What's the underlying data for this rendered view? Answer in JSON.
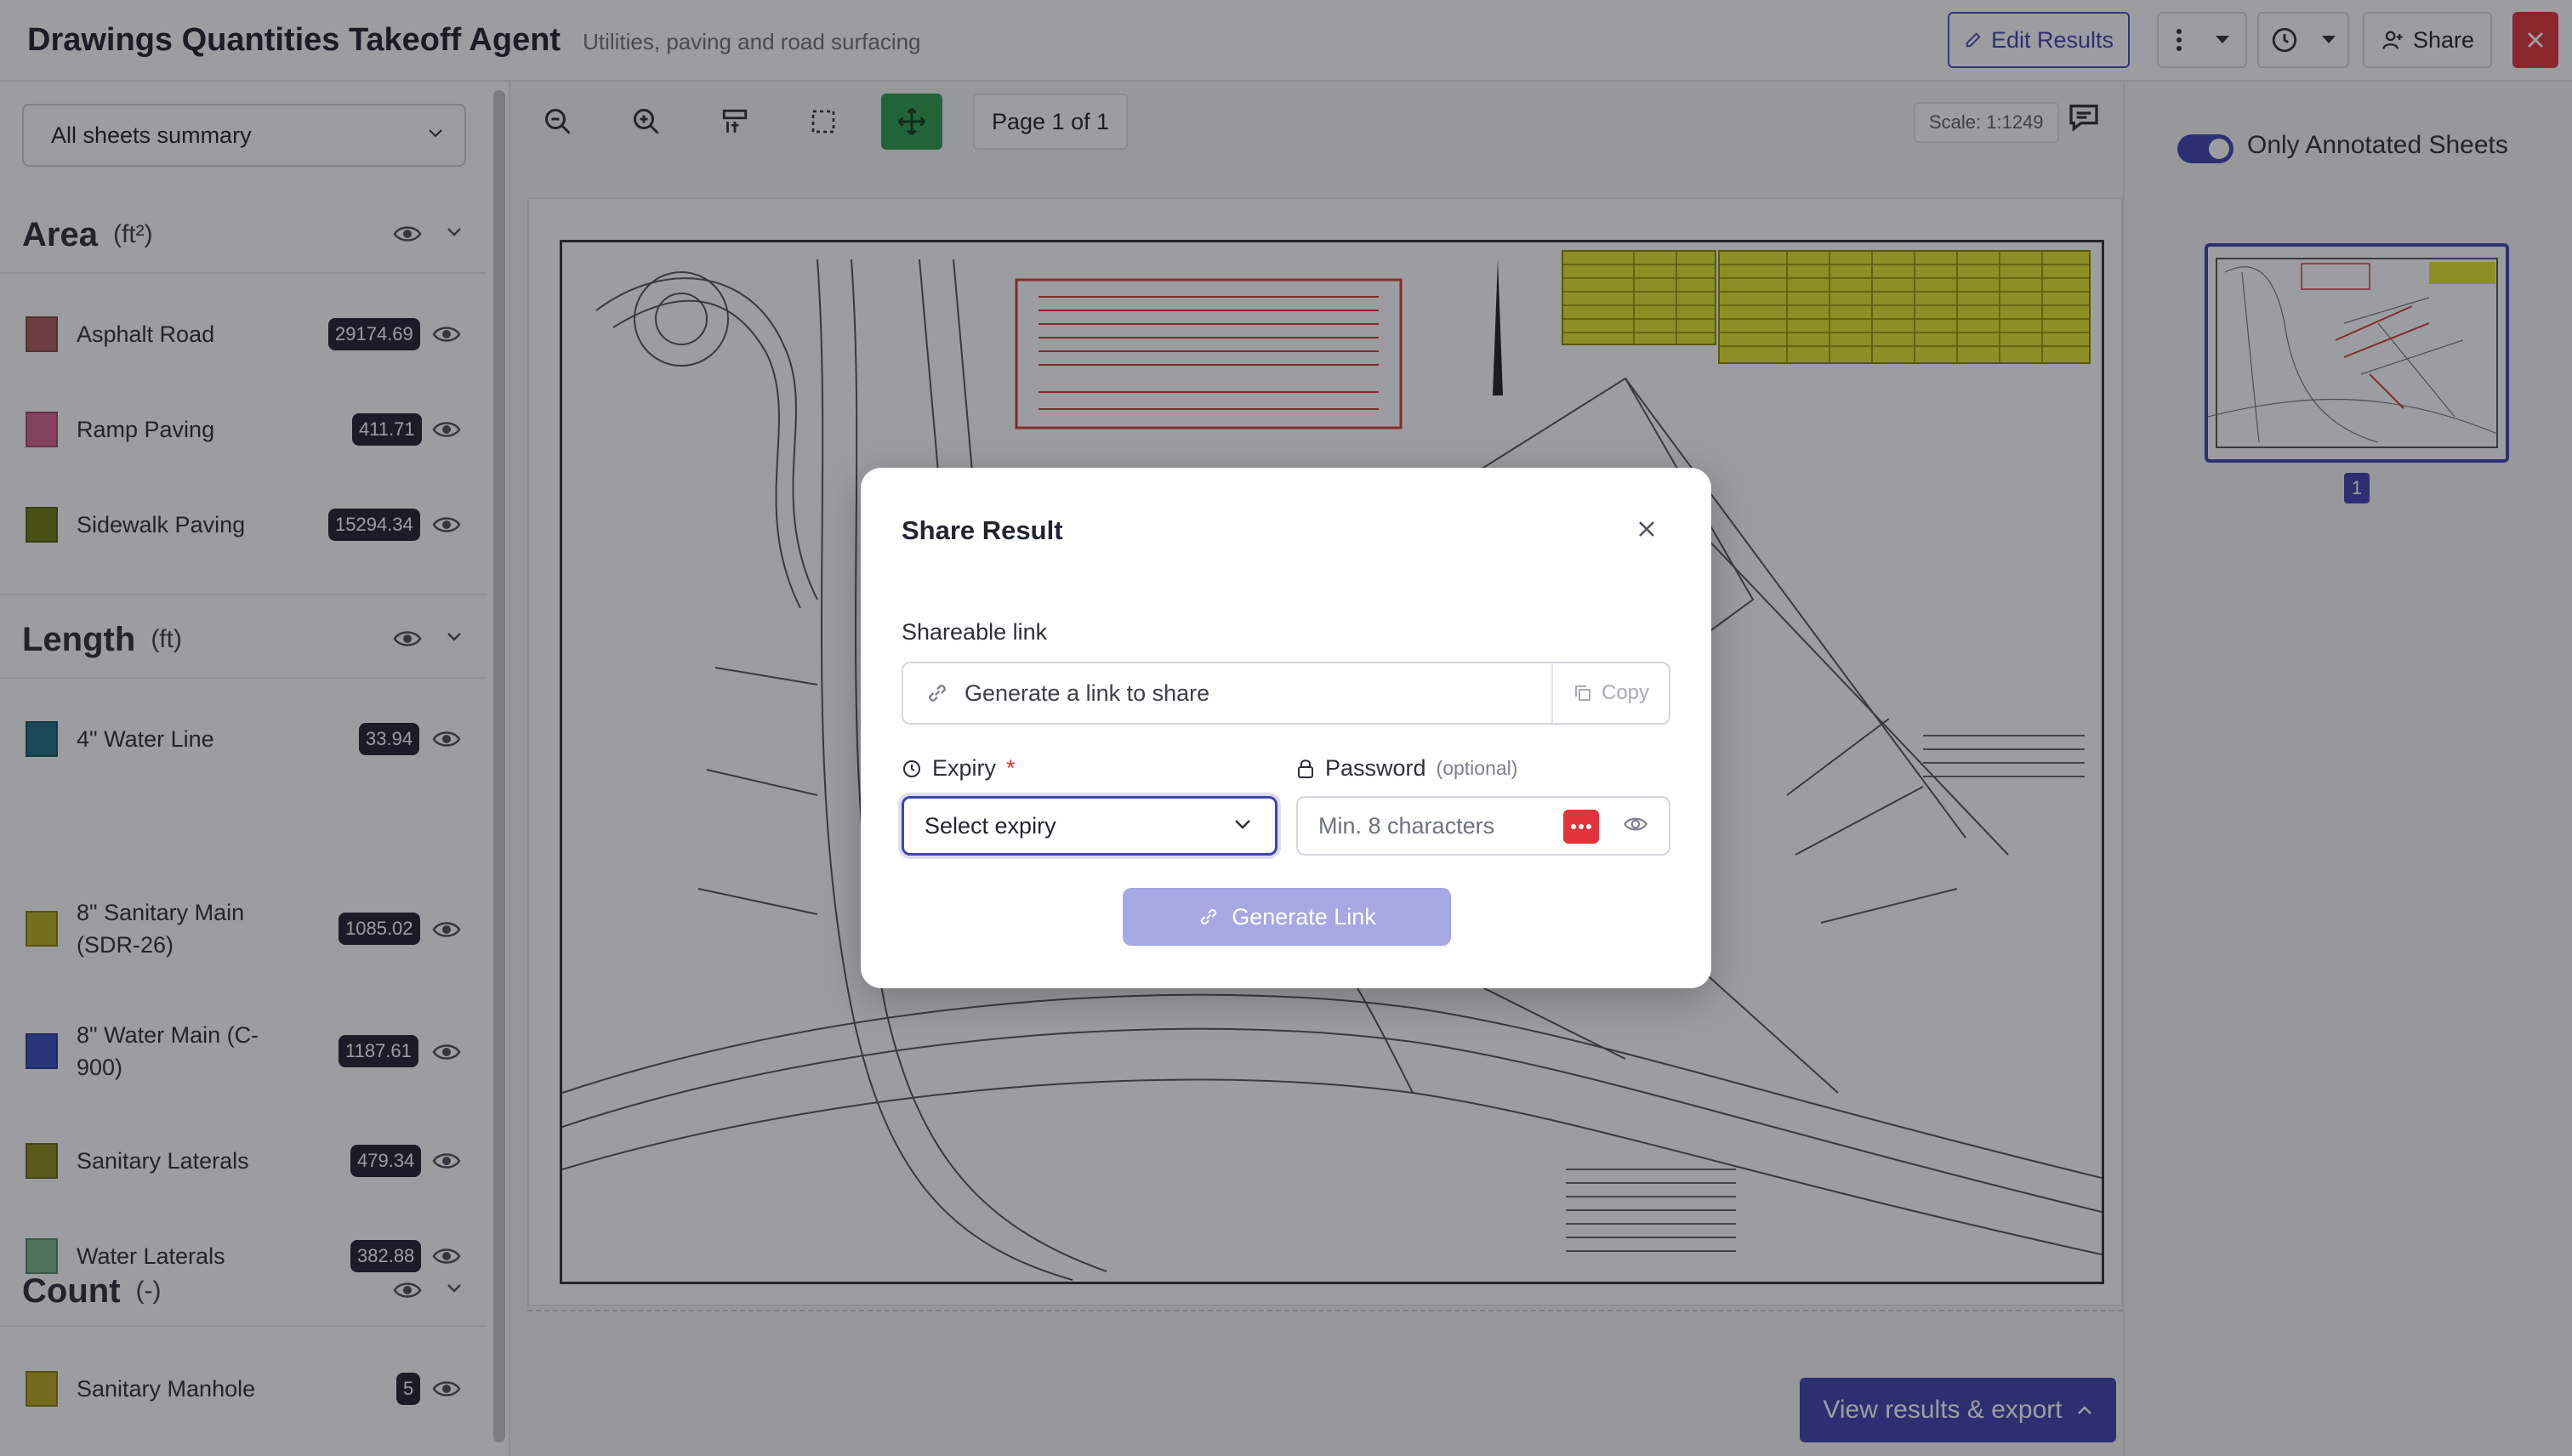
{
  "header": {
    "title": "Drawings Quantities Takeoff Agent",
    "subtitle": "Utilities, paving and road surfacing",
    "edit_results": "Edit Results",
    "share": "Share"
  },
  "sidebar": {
    "sheet_select": "All sheets summary",
    "sections": [
      {
        "title": "Area",
        "unit": "(ft²)",
        "items": [
          {
            "label": "Asphalt Road",
            "value": "29174.69",
            "color": "#b05a5a"
          },
          {
            "label": "Ramp Paving",
            "value": "411.71",
            "color": "#d4638f"
          },
          {
            "label": "Sidewalk Paving",
            "value": "15294.34",
            "color": "#6f7a14"
          }
        ]
      },
      {
        "title": "Length",
        "unit": "(ft)",
        "items": [
          {
            "label": "4\" Water Line",
            "value": "33.94",
            "color": "#1f6e7e"
          },
          {
            "label": "8\" Sanitary Main (SDR-26)",
            "value": "1085.02",
            "color": "#b8b01c"
          },
          {
            "label": "8\" Water Main (C-900)",
            "value": "1187.61",
            "color": "#3a4fc2"
          },
          {
            "label": "Sanitary Laterals",
            "value": "479.34",
            "color": "#8a8a1a"
          },
          {
            "label": "Water Laterals",
            "value": "382.88",
            "color": "#7ab58a"
          }
        ]
      },
      {
        "title": "Count",
        "unit": "(-)",
        "items": [
          {
            "label": "Sanitary Manhole",
            "value": "5",
            "color": "#b8a81c"
          }
        ]
      }
    ]
  },
  "toolbar": {
    "page_indicator": "Page 1 of 1",
    "scale": "Scale: 1:1249"
  },
  "right_panel": {
    "toggle_label": "Only Annotated Sheets",
    "thumb_number": "1"
  },
  "footer": {
    "export_button": "View results & export"
  },
  "modal": {
    "title": "Share Result",
    "link_label": "Shareable link",
    "link_placeholder": "Generate a link to share",
    "copy": "Copy",
    "expiry_label": "Expiry",
    "expiry_required": "*",
    "expiry_value": "Select expiry",
    "password_label": "Password",
    "password_optional": "(optional)",
    "password_placeholder": "Min. 8 characters",
    "generate_button": "Generate Link"
  },
  "colors": {
    "accent": "#3f44b0",
    "danger": "#e0343a",
    "active_tool": "#2e9d4a"
  }
}
